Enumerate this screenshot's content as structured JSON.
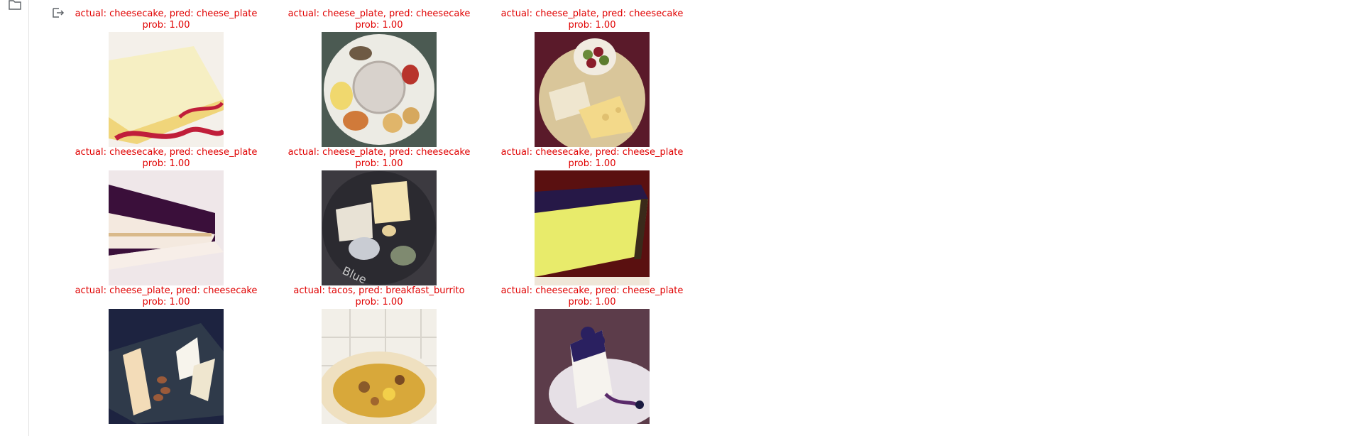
{
  "grid": [
    {
      "title": "actual: cheesecake, pred: cheese_plate",
      "prob": "prob: 1.00",
      "image": "cheesecake-slice-with-red-sauce"
    },
    {
      "title": "actual: cheese_plate, pred: cheesecake",
      "prob": "prob: 1.00",
      "image": "cheese-plate-white-dish"
    },
    {
      "title": "actual: cheese_plate, pred: cheesecake",
      "prob": "prob: 1.00",
      "image": "cheese-plate-with-grapes"
    },
    {
      "title": "actual: cheesecake, pred: cheese_plate",
      "prob": "prob: 1.00",
      "image": "cheesecake-with-blueberry-topping"
    },
    {
      "title": "actual: cheese_plate, pred: cheesecake",
      "prob": "prob: 1.00",
      "image": "cheese-on-slate-board"
    },
    {
      "title": "actual: cheesecake, pred: cheese_plate",
      "prob": "prob: 1.00",
      "image": "blueberry-cheesecake-slice"
    },
    {
      "title": "actual: cheese_plate, pred: cheesecake",
      "prob": "prob: 1.00",
      "image": "cheese-board-with-almonds"
    },
    {
      "title": "actual: tacos, pred: breakfast_burrito",
      "prob": "prob: 1.00",
      "image": "burrito-cross-section"
    },
    {
      "title": "actual: cheesecake, pred: cheese_plate",
      "prob": "prob: 1.00",
      "image": "cheesecake-with-blueberries"
    }
  ],
  "colors": {
    "title_text": "#e00000",
    "rail_border": "#e3e3e3"
  }
}
